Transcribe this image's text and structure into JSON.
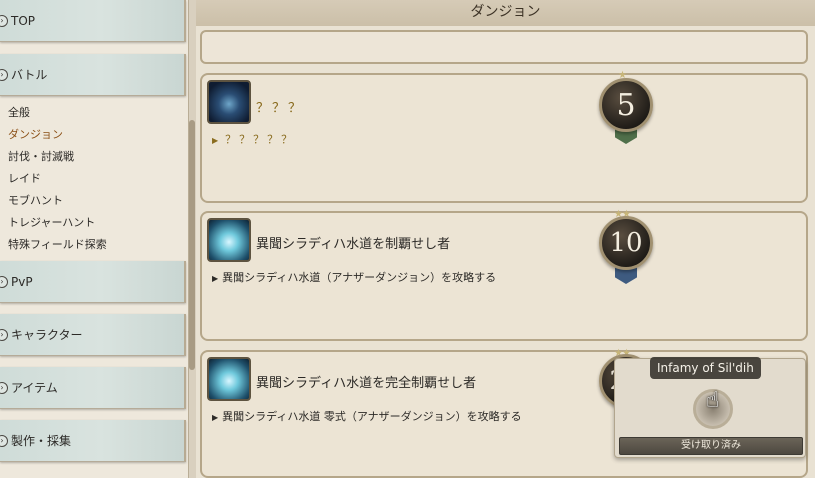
{
  "header": {
    "title": "ダンジョン"
  },
  "sidebar": {
    "categories": [
      {
        "label": "TOP"
      },
      {
        "label": "バトル"
      },
      {
        "label": "PvP"
      },
      {
        "label": "キャラクター"
      },
      {
        "label": "アイテム"
      },
      {
        "label": "製作・採集"
      }
    ],
    "battle_items": [
      {
        "label": "全般"
      },
      {
        "label": "ダンジョン"
      },
      {
        "label": "討伐・討滅戦"
      },
      {
        "label": "レイド"
      },
      {
        "label": "モブハント"
      },
      {
        "label": "トレジャーハント"
      },
      {
        "label": "特殊フィールド探索"
      }
    ]
  },
  "achievements": [
    {
      "title": "？？？",
      "description": "？？？？？",
      "points": "5",
      "stars": "★"
    },
    {
      "title": "異聞シラディハ水道を制覇せし者",
      "description": "異聞シラディハ水道（アナザーダンジョン）を攻略する",
      "points": "10",
      "stars": "★★"
    },
    {
      "title": "異聞シラディハ水道を完全制覇せし者",
      "description": "異聞シラディハ水道 零式（アナザーダンジョン）を攻略する",
      "points": "20",
      "stars": "★★"
    }
  ],
  "reward": {
    "tooltip": "Infamy of Sil'dih",
    "claimed_label": "受け取り済み"
  }
}
